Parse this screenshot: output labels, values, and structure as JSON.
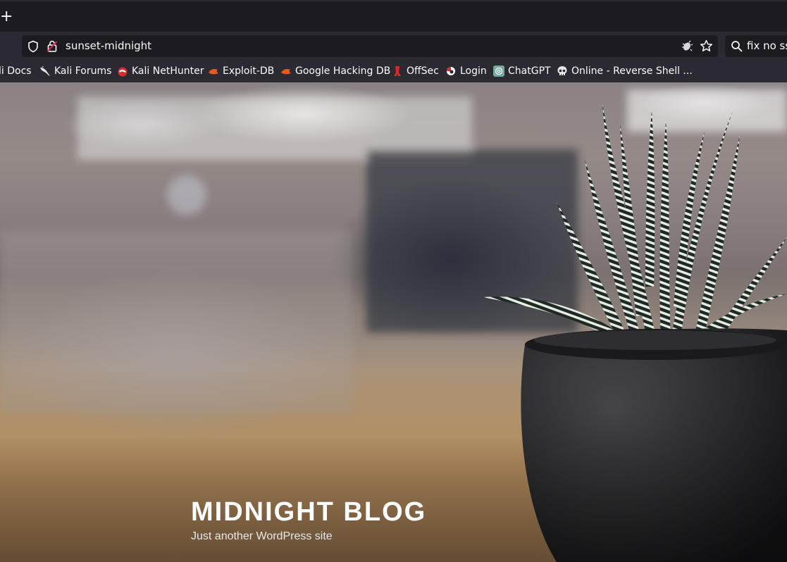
{
  "browser": {
    "new_tab_label": "+",
    "url": "sunset-midnight",
    "search_text": "fix no ssl",
    "bookmarks": [
      {
        "label": "li Docs",
        "icon": "kali-docs-icon"
      },
      {
        "label": "Kali Forums",
        "icon": "kali-dragon-icon"
      },
      {
        "label": "Kali NetHunter",
        "icon": "nethunter-icon"
      },
      {
        "label": "Exploit-DB",
        "icon": "exploit-db-icon"
      },
      {
        "label": "Google Hacking DB",
        "icon": "ghdb-icon"
      },
      {
        "label": "OffSec",
        "icon": "offsec-icon"
      },
      {
        "label": "Login",
        "icon": "login-icon"
      },
      {
        "label": "ChatGPT",
        "icon": "chatgpt-icon"
      },
      {
        "label": "Online - Reverse Shell ...",
        "icon": "skull-icon"
      }
    ]
  },
  "site": {
    "title": "MIDNIGHT BLOG",
    "description": "Just another WordPress site"
  },
  "colors": {
    "toolbar": "#2b2a33",
    "tabstrip": "#1c1b22",
    "field": "#1c1b22",
    "text": "#fbfbfe"
  }
}
